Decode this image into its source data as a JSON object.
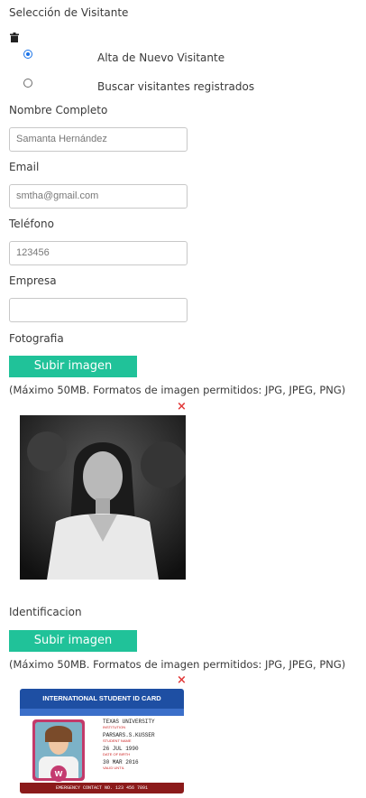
{
  "visitor_selection": {
    "title": "Selección de Visitante",
    "trash_icon": "trash-icon",
    "options": [
      {
        "label": "Alta de Nuevo Visitante",
        "checked": true
      },
      {
        "label": "Buscar visitantes registrados",
        "checked": false
      }
    ]
  },
  "form": {
    "name": {
      "label": "Nombre Completo",
      "value": "Samanta Hernández"
    },
    "email": {
      "label": "Email",
      "value": "smtha@gmail.com"
    },
    "phone": {
      "label": "Teléfono",
      "value": "123456"
    },
    "company": {
      "label": "Empresa",
      "value": ""
    }
  },
  "photo_section": {
    "label": "Fotografia",
    "button": "Subir imagen",
    "note": "(Máximo 50MB. Formatos de imagen permitidos: JPG, JPEG, PNG)",
    "remove": "×"
  },
  "id_section": {
    "label": "Identificacion",
    "button": "Subir imagen",
    "note": "(Máximo 50MB. Formatos de imagen permitidos: JPG, JPEG, PNG)",
    "remove": "×",
    "card": {
      "header": "INTERNATIONAL STUDENT ID CARD",
      "institution": "TEXAS UNIVERSITY",
      "institution_caption": "INSTITUTION",
      "student_name": "PARSARS.S.KUSSER",
      "student_name_caption": "STUDENT NAME",
      "dob": "26 JUL 1990",
      "dob_caption": "DATE OF BIRTH",
      "valid": "30 MAR 2016",
      "valid_caption": "VALID UNTIL",
      "footer": "EMERGENCY CONTACT NO. 123 456 7891"
    }
  },
  "colors": {
    "accent": "#20c299",
    "radio": "#1a73e8",
    "remove": "#e23b3b",
    "card_header": "#1e4fa3",
    "card_footer": "#8b1a1a"
  }
}
